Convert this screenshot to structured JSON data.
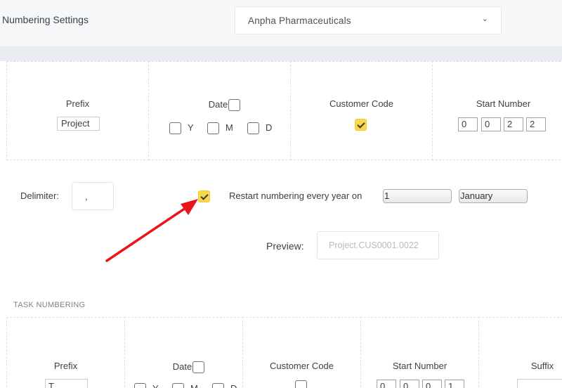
{
  "header": {
    "title": "Numbering Settings",
    "company": "Anpha Pharmaceuticals",
    "chevron": "⌄"
  },
  "project_numbering": {
    "prefix": {
      "label": "Prefix",
      "value": "Project"
    },
    "date": {
      "label": "Date",
      "checked": false,
      "options": [
        "Y",
        "M",
        "D"
      ]
    },
    "customer_code": {
      "label": "Customer Code",
      "checked": true
    },
    "start_number": {
      "label": "Start Number",
      "digits": [
        "0",
        "0",
        "2",
        "2"
      ]
    }
  },
  "options": {
    "delimiter_label": "Delimiter:",
    "delimiter_value": ",",
    "restart_checked": true,
    "restart_label": "Restart numbering every year on",
    "restart_day": "1",
    "restart_month": "January",
    "preview_label": "Preview:",
    "preview_value": "Project.CUS0001.0022"
  },
  "task_numbering": {
    "section_title": "TASK NUMBERING",
    "prefix": {
      "label": "Prefix",
      "value": "T"
    },
    "date": {
      "label": "Date",
      "checked": false,
      "options": [
        "Y",
        "M",
        "D"
      ]
    },
    "customer_code": {
      "label": "Customer Code",
      "checked": false
    },
    "start_number": {
      "label": "Start Number",
      "digits": [
        "0",
        "0",
        "0",
        "1"
      ]
    },
    "suffix": {
      "label": "Suffix"
    }
  },
  "colors": {
    "checkbox_checked": "#f9d64a",
    "arrow": "#e8161b",
    "topbar_bg": "#f5f7f9"
  }
}
